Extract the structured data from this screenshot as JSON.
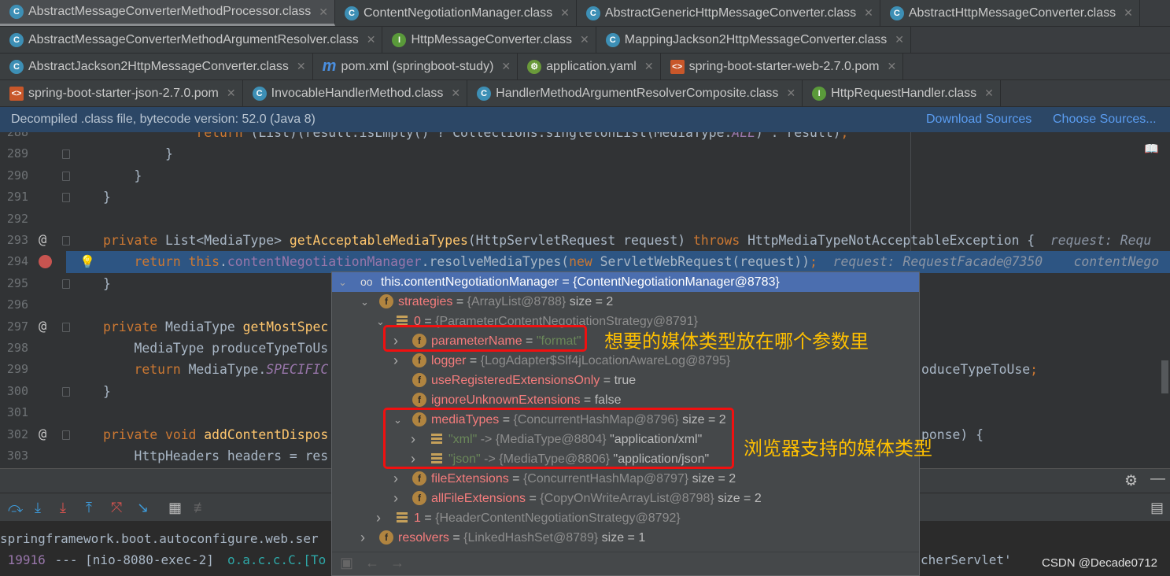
{
  "tabs": [
    [
      {
        "label": "AbstractMessageConverterMethodProcessor.class",
        "icon": "class-icon",
        "active": true
      },
      {
        "label": "ContentNegotiationManager.class",
        "icon": "class-icon"
      },
      {
        "label": "AbstractGenericHttpMessageConverter.class",
        "icon": "class-icon"
      },
      {
        "label": "AbstractHttpMessageConverter.class",
        "icon": "class-icon"
      }
    ],
    [
      {
        "label": "AbstractMessageConverterMethodArgumentResolver.class",
        "icon": "class-icon"
      },
      {
        "label": "HttpMessageConverter.class",
        "icon": "interface-icon"
      },
      {
        "label": "MappingJackson2HttpMessageConverter.class",
        "icon": "class-icon"
      }
    ],
    [
      {
        "label": "AbstractJackson2HttpMessageConverter.class",
        "icon": "class-icon"
      },
      {
        "label": "pom.xml (springboot-study)",
        "icon": "maven-icon"
      },
      {
        "label": "application.yaml",
        "icon": "spring-icon"
      },
      {
        "label": "spring-boot-starter-web-2.7.0.pom",
        "icon": "xml-file-icon"
      }
    ],
    [
      {
        "label": "spring-boot-starter-json-2.7.0.pom",
        "icon": "xml-file-icon"
      },
      {
        "label": "InvocableHandlerMethod.class",
        "icon": "class-icon"
      },
      {
        "label": "HandlerMethodArgumentResolverComposite.class",
        "icon": "class-icon"
      },
      {
        "label": "HttpRequestHandler.class",
        "icon": "interface-icon"
      }
    ]
  ],
  "banner": {
    "text": "Decompiled .class file, bytecode version: 52.0 (Java 8)",
    "download": "Download Sources",
    "choose": "Choose Sources..."
  },
  "colors": {
    "accent": "#4b6eaf",
    "keyword": "#cc7832",
    "field": "#f47c7c",
    "annotation": "#ffc000",
    "highlight": "#f01010"
  },
  "code": [
    {
      "n": "288",
      "t": [
        [
          "            "
        ],
        [
          "return",
          "kw"
        ],
        [
          " (List)(result.isEmpty() ? Collections.singletonList(MediaType."
        ],
        [
          "ALL",
          "it"
        ],
        [
          ") : result)"
        ],
        [
          ";",
          "kw"
        ]
      ]
    },
    {
      "n": "289",
      "fold": true,
      "t": [
        [
          "        }"
        ]
      ]
    },
    {
      "n": "290",
      "fold": true,
      "t": [
        [
          "    }"
        ]
      ]
    },
    {
      "n": "291",
      "fold": true,
      "t": [
        [
          "}"
        ]
      ]
    },
    {
      "n": "292",
      "t": []
    },
    {
      "n": "293",
      "g": "@",
      "fold": true,
      "t": [
        [
          "private ",
          "kw"
        ],
        [
          "List<MediaType> "
        ],
        [
          "getAcceptableMediaTypes",
          "fn"
        ],
        [
          "(HttpServletRequest request) "
        ],
        [
          "throws ",
          "kw"
        ],
        [
          "HttpMediaTypeNotAcceptableException {  "
        ],
        [
          "request: Requ",
          "hint"
        ]
      ]
    },
    {
      "n": "294",
      "bp": true,
      "hl": true,
      "t": [
        [
          "    "
        ],
        [
          "return ",
          "kw"
        ],
        [
          "this",
          "kw"
        ],
        [
          "."
        ],
        [
          "contentNegotiationManager",
          "fld"
        ],
        [
          ".resolveMediaTypes("
        ],
        [
          "new ",
          "kw"
        ],
        [
          "ServletWebRequest(request))"
        ],
        [
          ";",
          "kw"
        ],
        [
          "  request: RequestFacade@7350    contentNego",
          "hint"
        ]
      ]
    },
    {
      "n": "295",
      "fold": true,
      "t": [
        [
          "}"
        ]
      ]
    },
    {
      "n": "296",
      "t": []
    },
    {
      "n": "297",
      "g": "@",
      "fold": true,
      "t": [
        [
          "private ",
          "kw"
        ],
        [
          "MediaType "
        ],
        [
          "getMostSpec",
          "fn"
        ]
      ]
    },
    {
      "n": "298",
      "t": [
        [
          "    MediaType produceTypeToUs"
        ]
      ]
    },
    {
      "n": "299",
      "t": [
        [
          "    "
        ],
        [
          "return ",
          "kw"
        ],
        [
          "MediaType."
        ],
        [
          "SPECIFIC",
          "it"
        ]
      ],
      "r": [
        [
          "oduceTypeToUse"
        ],
        [
          ";",
          "kw"
        ]
      ]
    },
    {
      "n": "300",
      "fold": true,
      "t": [
        [
          "}"
        ]
      ]
    },
    {
      "n": "301",
      "t": []
    },
    {
      "n": "302",
      "g": "@",
      "fold": true,
      "t": [
        [
          "private ",
          "kw"
        ],
        [
          "void ",
          "kw"
        ],
        [
          "addContentDispos",
          "fn"
        ]
      ],
      "r": [
        [
          "ponse) {"
        ]
      ]
    },
    {
      "n": "303",
      "t": [
        [
          "    HttpHeaders headers = res"
        ]
      ]
    }
  ],
  "popup": {
    "rows": [
      {
        "lvl": 0,
        "arrow": "open",
        "icon": "watch-icon",
        "name": "this.contentNegotiationManager",
        "val": "{ContentNegotiationManager@8783}",
        "sel": true
      },
      {
        "lvl": 1,
        "arrow": "open",
        "icon": "field-icon",
        "name": "strategies",
        "val": "{ArrayList@8788}",
        "extra": "size = 2"
      },
      {
        "lvl": 2,
        "arrow": "open",
        "icon": "array-item-icon",
        "name": "0",
        "val": "{ParameterContentNegotiationStrategy@8791}",
        "num": true
      },
      {
        "lvl": 3,
        "arrow": "closed",
        "icon": "field-icon",
        "name": "parameterName",
        "str": "\"format\""
      },
      {
        "lvl": 3,
        "arrow": "closed",
        "icon": "field-icon",
        "name": "logger",
        "val": "{LogAdapter$Slf4jLocationAwareLog@8795}"
      },
      {
        "lvl": 3,
        "icon": "field-icon",
        "name": "useRegisteredExtensionsOnly",
        "extra": "true"
      },
      {
        "lvl": 3,
        "icon": "field-icon",
        "name": "ignoreUnknownExtensions",
        "extra": "false"
      },
      {
        "lvl": 3,
        "arrow": "open",
        "icon": "field-icon",
        "name": "mediaTypes",
        "val": "{ConcurrentHashMap@8796}",
        "extra": "size = 2"
      },
      {
        "lvl": 4,
        "arrow": "closed",
        "icon": "map-entry-icon",
        "key": "\"xml\"",
        "val": "-> {MediaType@8804}",
        "extra": "\"application/xml\""
      },
      {
        "lvl": 4,
        "arrow": "closed",
        "icon": "map-entry-icon",
        "key": "\"json\"",
        "val": "-> {MediaType@8806}",
        "extra": "\"application/json\""
      },
      {
        "lvl": 3,
        "arrow": "closed",
        "icon": "field-icon",
        "name": "fileExtensions",
        "val": "{ConcurrentHashMap@8797}",
        "extra": "size = 2"
      },
      {
        "lvl": 3,
        "arrow": "closed",
        "icon": "field-icon",
        "name": "allFileExtensions",
        "val": "{CopyOnWriteArrayList@8798}",
        "extra": "size = 2"
      },
      {
        "lvl": 2,
        "arrow": "closed",
        "icon": "array-item-icon",
        "name": "1",
        "val": "{HeaderContentNegotiationStrategy@8792}",
        "num": true
      },
      {
        "lvl": 1,
        "arrow": "closed",
        "icon": "field-icon",
        "name": "resolvers",
        "val": "{LinkedHashSet@8789}",
        "extra": "size = 1"
      }
    ]
  },
  "annotations": {
    "param": "想要的媒体类型放在哪个参数里",
    "media": "浏览器支持的媒体类型"
  },
  "console": {
    "line1": "springframework.boot.autoconfigure.web.ser",
    "pid": " 19916",
    "sep": " --- [nio-8080-exec-2] ",
    "logger": "o.a.c.c.C.[To",
    "tail": "cherServlet'"
  },
  "watermark": "CSDN @Decade0712"
}
